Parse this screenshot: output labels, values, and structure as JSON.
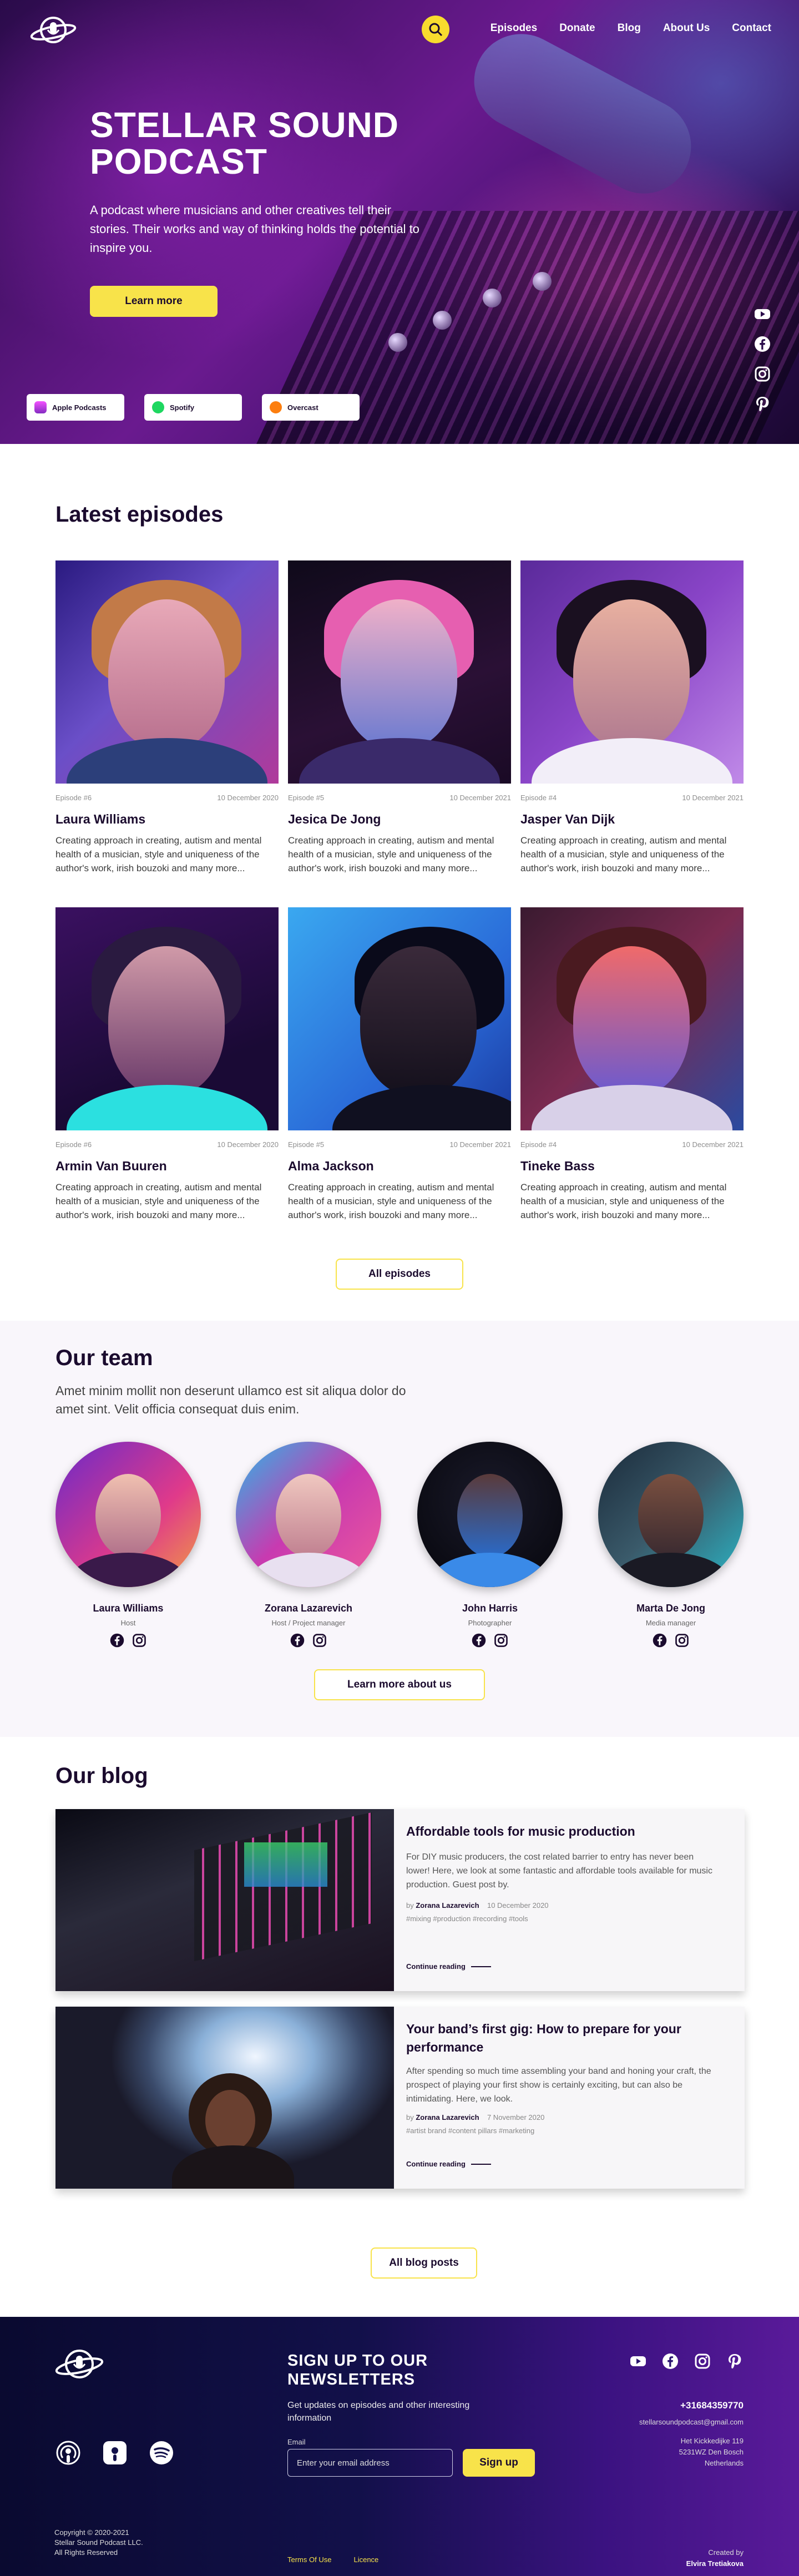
{
  "nav": {
    "links": [
      "Episodes",
      "Donate",
      "Blog",
      "About Us",
      "Contact"
    ]
  },
  "hero": {
    "title": "STELLAR SOUND PODCAST",
    "subtitle": "A podcast  where musicians and other creatives tell their stories. Their works and way of thinking holds the potential to inspire you.",
    "cta": "Learn more",
    "platforms": [
      "Apple Podcasts",
      "Spotify",
      "Overcast"
    ]
  },
  "episodes": {
    "title": "Latest episodes",
    "items": [
      {
        "number": "Episode #6",
        "date": "10 December 2020",
        "name": "Laura Williams",
        "desc": "Creating approach in creating, autism and mental health of a musician, style and uniqueness of the author's work, irish bouzoki and many more..."
      },
      {
        "number": "Episode #5",
        "date": "10 December 2021",
        "name": "Jesica De Jong",
        "desc": "Creating approach in creating, autism and mental health of a musician, style and uniqueness of the author's work, irish bouzoki and many more..."
      },
      {
        "number": "Episode #4",
        "date": "10 December 2021",
        "name": "Jasper Van Dijk",
        "desc": "Creating approach in creating, autism and mental health of a musician, style and uniqueness of the author's work, irish bouzoki and many more..."
      },
      {
        "number": "Episode #6",
        "date": "10 December 2020",
        "name": "Armin Van Buuren",
        "desc": "Creating approach in creating, autism and mental health of a musician, style and uniqueness of the author's work, irish bouzoki and many more..."
      },
      {
        "number": "Episode #5",
        "date": "10 December 2021",
        "name": "Alma Jackson",
        "desc": "Creating approach in creating, autism and mental health of a musician, style and uniqueness of the author's work, irish bouzoki and many more..."
      },
      {
        "number": "Episode #4",
        "date": "10 December 2021",
        "name": "Tineke Bass",
        "desc": "Creating approach in creating, autism and mental health of a musician, style and uniqueness of the author's work, irish bouzoki and many more..."
      }
    ],
    "all_button": "All episodes"
  },
  "team": {
    "title": "Our team",
    "intro": "Amet minim mollit non deserunt ullamco est sit aliqua dolor do amet sint. Velit officia consequat duis enim.",
    "members": [
      {
        "name": "Laura Williams",
        "role": "Host"
      },
      {
        "name": "Zorana Lazarevich",
        "role": "Host / Project manager"
      },
      {
        "name": "John Harris",
        "role": "Photographer"
      },
      {
        "name": "Marta De Jong",
        "role": "Media manager"
      }
    ],
    "more_button": "Learn more about us"
  },
  "blog": {
    "title": "Our blog",
    "posts": [
      {
        "title": "Affordable tools for music production",
        "body": "For DIY music producers, the cost related barrier to entry has never been lower! Here, we look at some fantastic and affordable tools available for music production. Guest post by.",
        "by_prefix": "by",
        "author": "Zorana Lazarevich",
        "date": "10 December 2020",
        "tags": "#mixing #production #recording #tools",
        "more": "Continue reading"
      },
      {
        "title": "Your band’s first gig: How to prepare for your performance",
        "body": "After spending so much time assembling your band and honing your craft, the prospect of playing your first show is certainly exciting, but can also be intimidating. Here, we look.",
        "by_prefix": "by",
        "author": "Zorana Lazarevich",
        "date": "7 November 2020",
        "tags": "#artist brand #content pillars #marketing",
        "more": "Continue reading"
      }
    ],
    "all_button": "All blog posts"
  },
  "footer": {
    "newsletter_title": "SIGN UP TO OUR NEWSLETTERS",
    "newsletter_sub": "Get updates on episodes and other interesting information",
    "email_label": "Email",
    "email_placeholder": "Enter your email address",
    "signup": "Sign up",
    "phone": "+31684359770",
    "email": "stellarsoundpodcast@gmail.com",
    "address_1": "Het Kickkedijke 119",
    "address_2": "5231WZ Den Bosch",
    "address_3": "Netherlands",
    "copy_1": "Copyright © 2020-2021",
    "copy_2": "Stellar Sound Podcast LLC.",
    "copy_3": "All Rights Reserved",
    "terms": "Terms Of Use",
    "licence": "Licence",
    "credit_label": "Created by",
    "credit_name": "Elvira Tretiakova"
  },
  "colors": {
    "accent": "#f8e34a",
    "dark": "#1b0b2e",
    "footer_start": "#0a0a30",
    "footer_end": "#5a1a9a"
  },
  "icons": [
    "logo-planet-icon",
    "search-icon",
    "youtube-icon",
    "facebook-icon",
    "instagram-icon",
    "pinterest-icon",
    "apple-podcasts-icon",
    "spotify-icon",
    "overcast-icon",
    "arrow-right-icon"
  ]
}
